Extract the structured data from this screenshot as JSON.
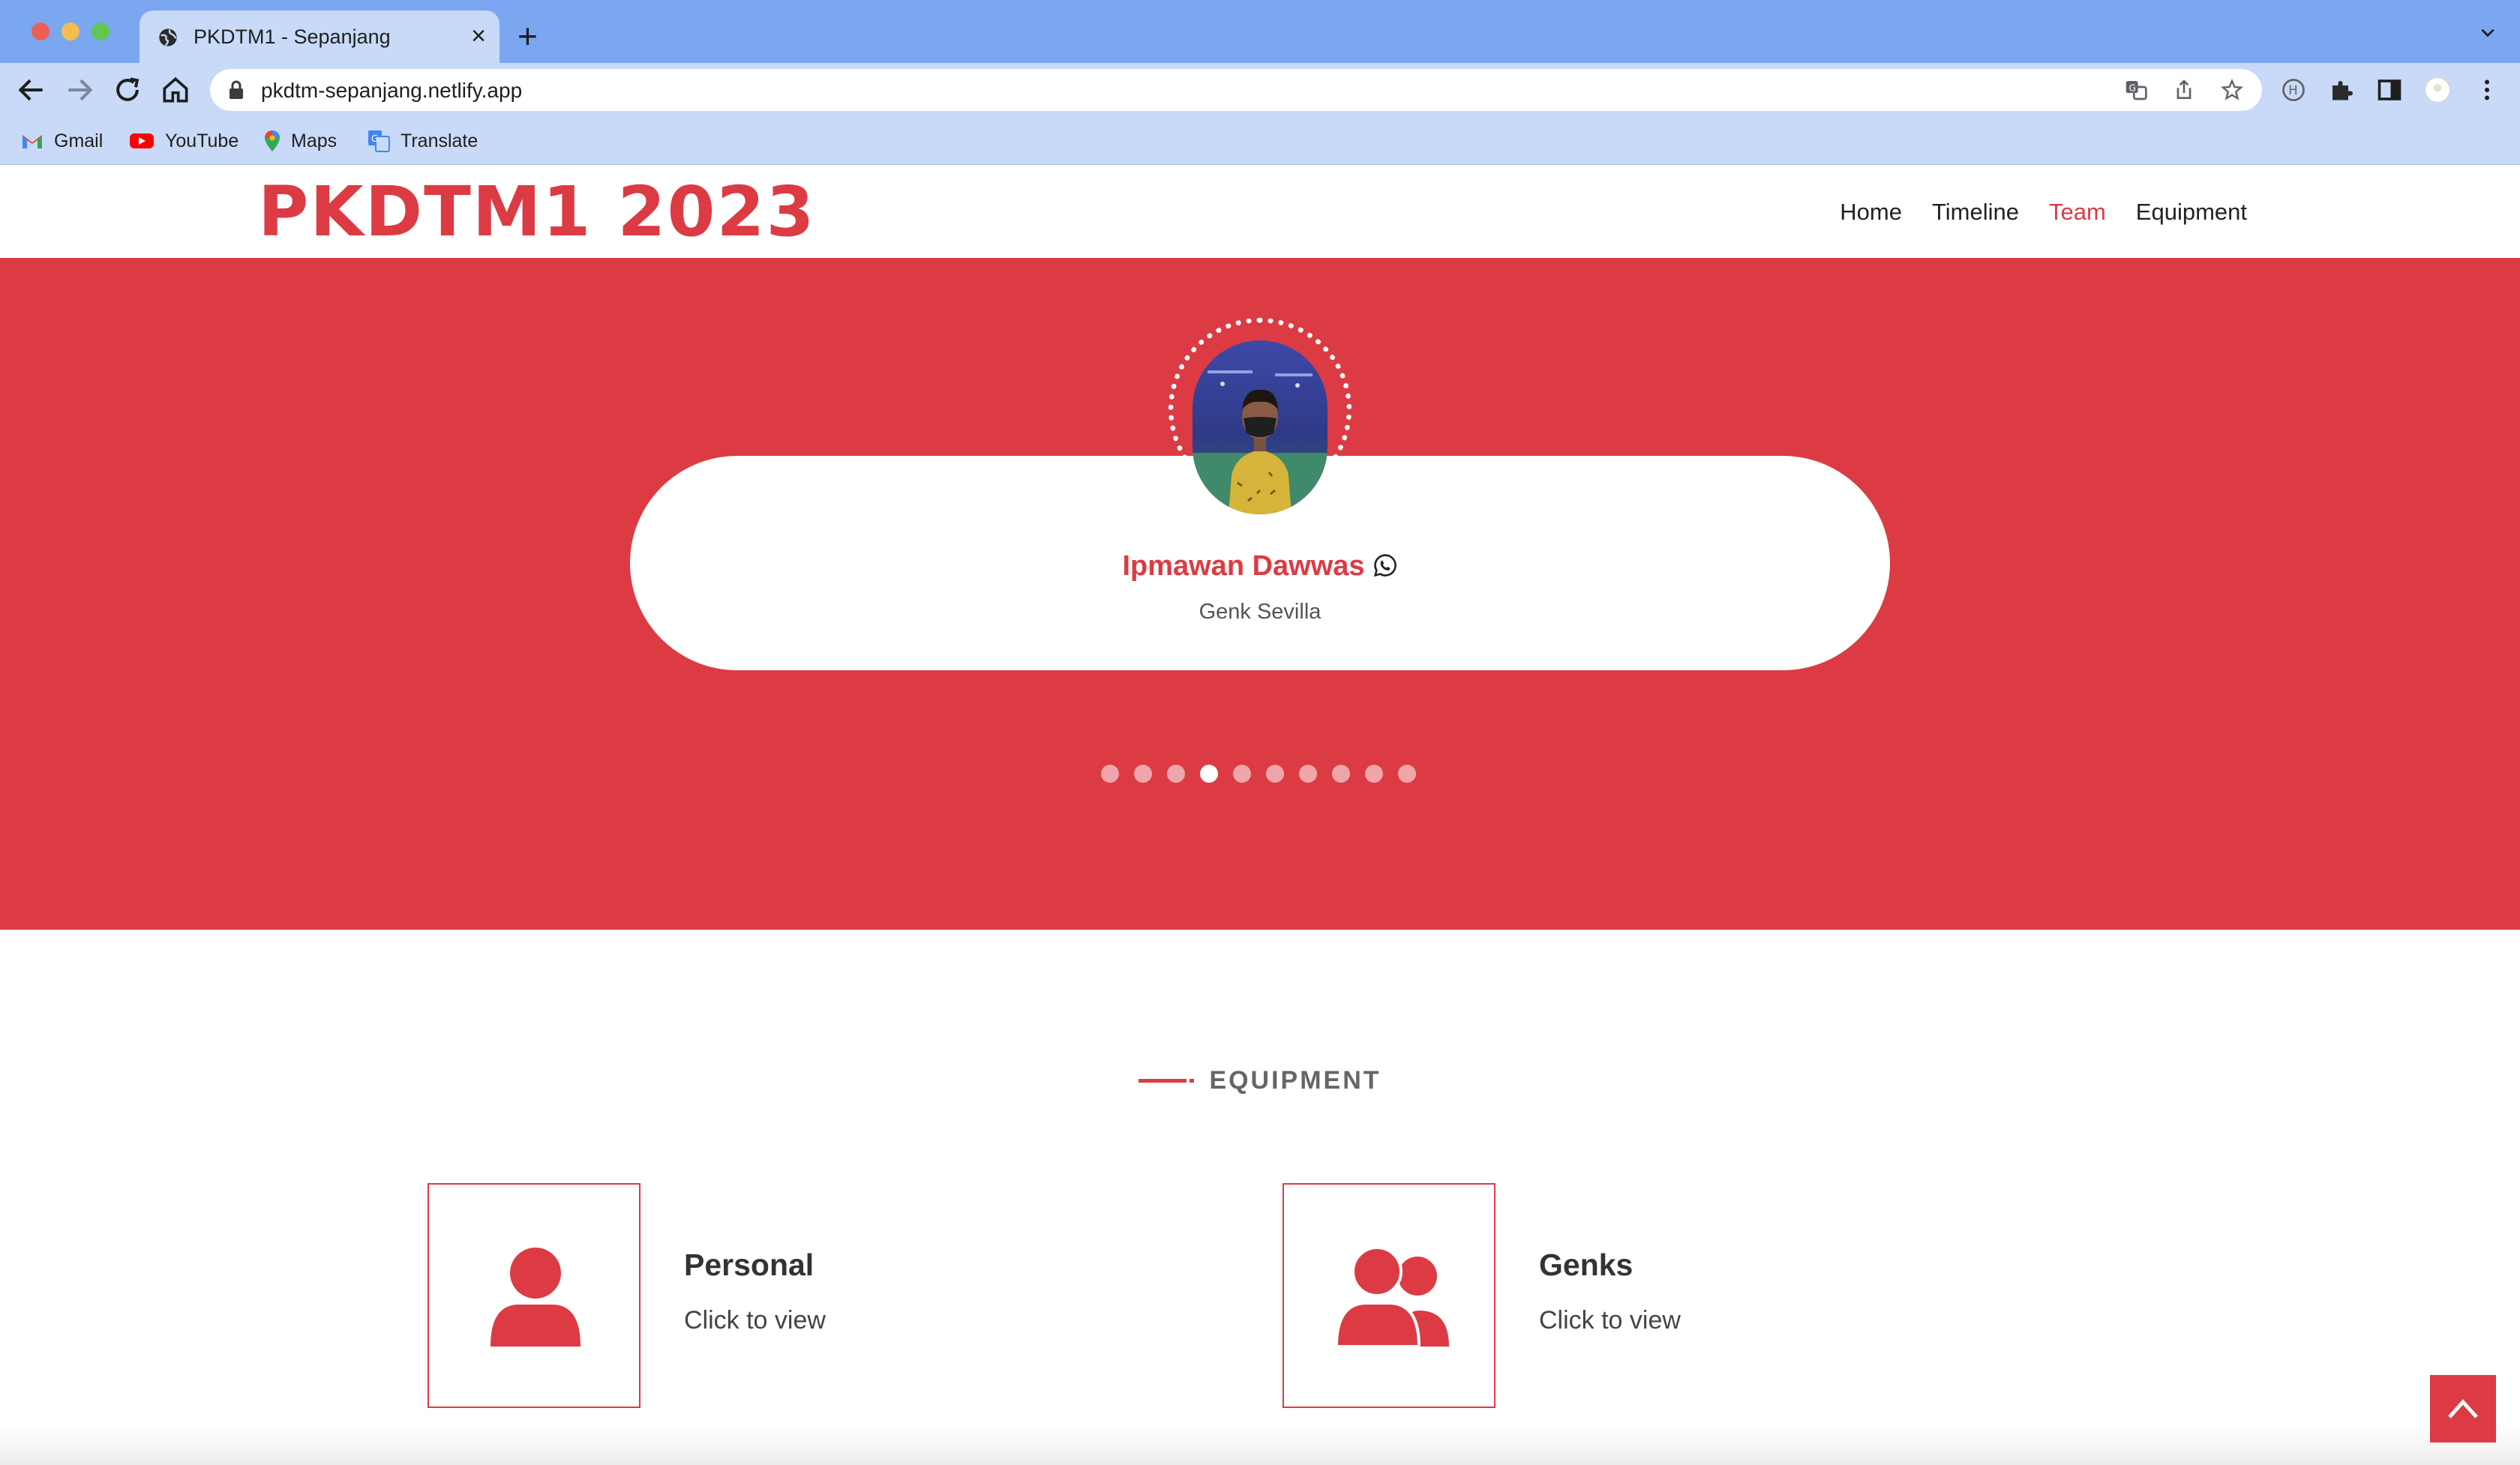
{
  "browser": {
    "tab_title": "PKDTM1 - Sepanjang",
    "new_tab_symbol": "+",
    "close_symbol": "×",
    "url": "pkdtm-sepanjang.netlify.app",
    "bookmarks": [
      {
        "label": "Gmail",
        "icon": "gmail-icon"
      },
      {
        "label": "YouTube",
        "icon": "youtube-icon"
      },
      {
        "label": "Maps",
        "icon": "maps-icon"
      },
      {
        "label": "Translate",
        "icon": "translate-icon"
      }
    ],
    "colors": {
      "tab_strip": "#7ba6f0",
      "toolbar": "#c8daf7"
    }
  },
  "site": {
    "logo": "PKDTM1 2023",
    "nav": [
      {
        "label": "Home",
        "active": false
      },
      {
        "label": "Timeline",
        "active": false
      },
      {
        "label": "Team",
        "active": true
      },
      {
        "label": "Equipment",
        "active": false
      }
    ],
    "accent_color": "#dc3b44"
  },
  "team": {
    "member_name": "Ipmawan Dawwas",
    "member_role": "Genk Sevilla",
    "contact_icon": "whatsapp-icon",
    "carousel_total": 10,
    "carousel_active_index": 3
  },
  "equipment": {
    "heading": "EQUIPMENT",
    "items": [
      {
        "title": "Personal",
        "subtitle": "Click to view",
        "icon": "user-icon"
      },
      {
        "title": "Genks",
        "subtitle": "Click to view",
        "icon": "users-icon"
      }
    ]
  },
  "back_to_top_icon": "chevron-up-icon"
}
